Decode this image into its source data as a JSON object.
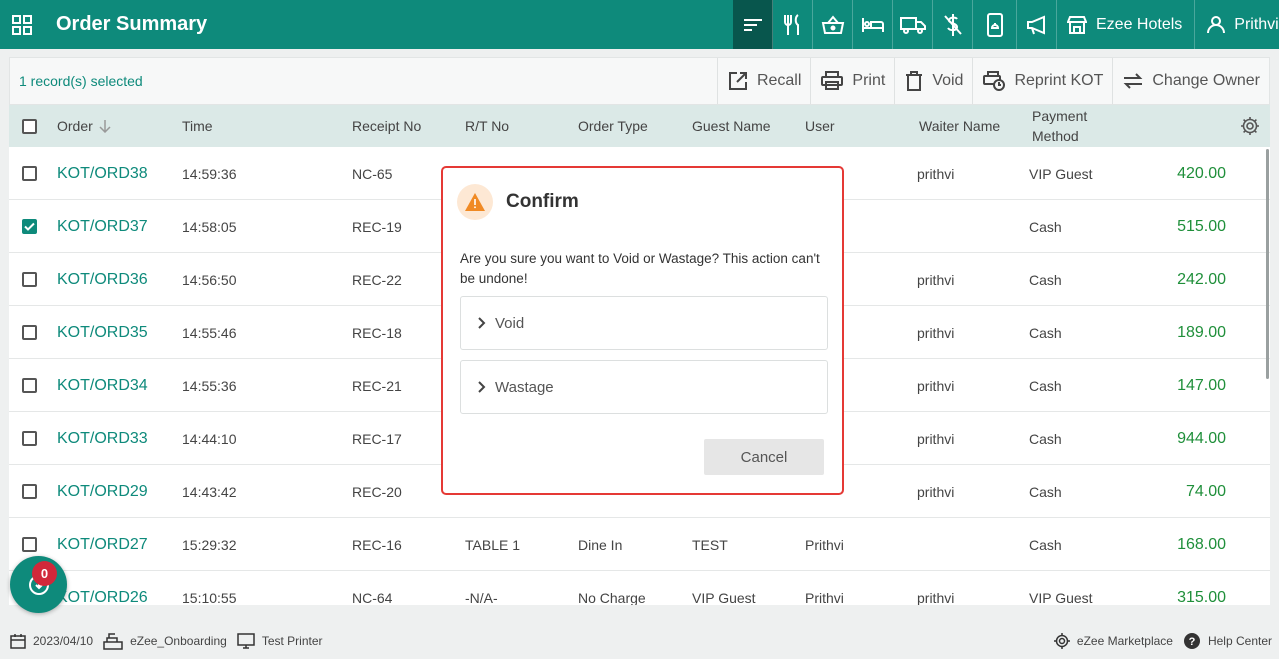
{
  "header": {
    "title": "Order Summary",
    "hotel": "Ezee Hotels",
    "user": "Prithvi",
    "icons": [
      "sort-icon",
      "restaurant-icon",
      "basket-icon",
      "bed-icon",
      "truck-icon",
      "no-dollar-icon",
      "phone-bell-icon",
      "megaphone-icon"
    ]
  },
  "toolbar": {
    "selected": "1 record(s) selected",
    "actions": {
      "recall": "Recall",
      "print": "Print",
      "void": "Void",
      "reprint": "Reprint KOT",
      "change_owner": "Change Owner"
    }
  },
  "table": {
    "headers": {
      "order": "Order",
      "time": "Time",
      "receipt": "Receipt No",
      "rt": "R/T No",
      "order_type": "Order Type",
      "guest": "Guest Name",
      "user": "User",
      "waiter": "Waiter Name",
      "payment_1": "Payment",
      "payment_2": "Method"
    },
    "rows": [
      {
        "order": "KOT/ORD38",
        "time": "14:59:36",
        "receipt": "NC-65",
        "rt": "",
        "order_type": "",
        "guest": "",
        "user": "",
        "waiter": "prithvi",
        "payment": "VIP Guest",
        "amount": "420.00",
        "checked": false
      },
      {
        "order": "KOT/ORD37",
        "time": "14:58:05",
        "receipt": "REC-19",
        "rt": "",
        "order_type": "",
        "guest": "",
        "user": "",
        "waiter": "",
        "payment": "Cash",
        "amount": "515.00",
        "checked": true
      },
      {
        "order": "KOT/ORD36",
        "time": "14:56:50",
        "receipt": "REC-22",
        "rt": "",
        "order_type": "",
        "guest": "",
        "user": "",
        "waiter": "prithvi",
        "payment": "Cash",
        "amount": "242.00",
        "checked": false
      },
      {
        "order": "KOT/ORD35",
        "time": "14:55:46",
        "receipt": "REC-18",
        "rt": "",
        "order_type": "",
        "guest": "",
        "user": "",
        "waiter": "prithvi",
        "payment": "Cash",
        "amount": "189.00",
        "checked": false
      },
      {
        "order": "KOT/ORD34",
        "time": "14:55:36",
        "receipt": "REC-21",
        "rt": "",
        "order_type": "",
        "guest": "",
        "user": "",
        "waiter": "prithvi",
        "payment": "Cash",
        "amount": "147.00",
        "checked": false
      },
      {
        "order": "KOT/ORD33",
        "time": "14:44:10",
        "receipt": "REC-17",
        "rt": "",
        "order_type": "",
        "guest": "",
        "user": "",
        "waiter": "prithvi",
        "payment": "Cash",
        "amount": "944.00",
        "checked": false
      },
      {
        "order": "KOT/ORD29",
        "time": "14:43:42",
        "receipt": "REC-20",
        "rt": "",
        "order_type": "",
        "guest": "",
        "user": "",
        "waiter": "prithvi",
        "payment": "Cash",
        "amount": "74.00",
        "checked": false
      },
      {
        "order": "KOT/ORD27",
        "time": "15:29:32",
        "receipt": "REC-16",
        "rt": "TABLE 1",
        "order_type": "Dine In",
        "guest": "TEST",
        "user": "Prithvi",
        "waiter": "",
        "payment": "Cash",
        "amount": "168.00",
        "checked": false
      },
      {
        "order": "KOT/ORD26",
        "time": "15:10:55",
        "receipt": "NC-64",
        "rt": "-N/A-",
        "order_type": "No Charge",
        "guest": "VIP Guest",
        "user": "Prithvi",
        "waiter": "prithvi",
        "payment": "VIP Guest",
        "amount": "315.00",
        "checked": false
      }
    ]
  },
  "dialog": {
    "title": "Confirm",
    "message": "Are you sure you want to Void or Wastage? This action can't be undone!",
    "option_void": "Void",
    "option_wastage": "Wastage",
    "cancel": "Cancel"
  },
  "fab": {
    "badge": "0"
  },
  "footer": {
    "date": "2023/04/10",
    "property": "eZee_Onboarding",
    "printer": "Test Printer",
    "marketplace": "eZee Marketplace",
    "help": "Help Center"
  },
  "colors": {
    "primary": "#0e8a7b",
    "amount": "#1f8f3a",
    "alert": "#e53935"
  }
}
